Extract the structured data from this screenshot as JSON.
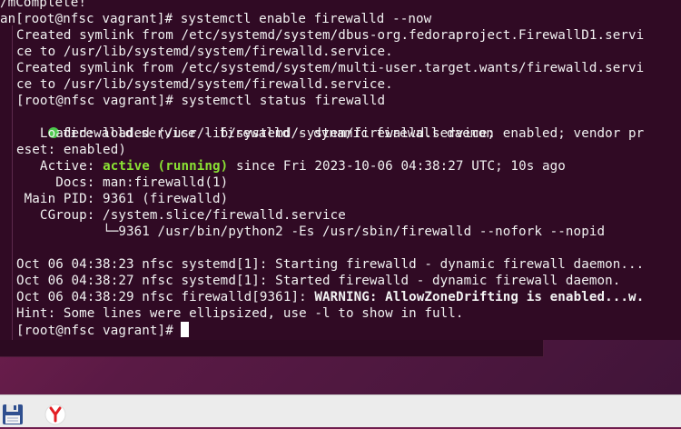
{
  "terminal": {
    "lines": [
      {
        "text": "/mComplete!"
      },
      {
        "text": "an[root@nfsc vagrant]# systemctl enable firewalld --now"
      },
      {
        "text": "Created symlink from /etc/systemd/system/dbus-org.fedoraproject.FirewallD1.servi"
      },
      {
        "text": "ce to /usr/lib/systemd/system/firewalld.service."
      },
      {
        "text": "Created symlink from /etc/systemd/system/multi-user.target.wants/firewalld.servi"
      },
      {
        "text": "ce to /usr/lib/systemd/system/firewalld.service."
      },
      {
        "text": "[root@nfsc vagrant]# systemctl status firewalld"
      },
      {
        "text": "firewalld.service - firewalld - dynamic firewall daemon"
      },
      {
        "text": "   Loaded: loaded (/usr/lib/systemd/system/firewalld.service; enabled; vendor pr"
      },
      {
        "text": "eset: enabled)"
      },
      {
        "prefix": "   Active: ",
        "highlight": "active (running)",
        "suffix": " since Fri 2023-10-06 04:38:27 UTC; 10s ago"
      },
      {
        "text": "     Docs: man:firewalld(1)"
      },
      {
        "text": " Main PID: 9361 (firewalld)"
      },
      {
        "text": "   CGroup: /system.slice/firewalld.service"
      },
      {
        "text": "           └─9361 /usr/bin/python2 -Es /usr/sbin/firewalld --nofork --nopid"
      },
      {
        "text": ""
      },
      {
        "text": "Oct 06 04:38:23 nfsc systemd[1]: Starting firewalld - dynamic firewall daemon..."
      },
      {
        "text": "Oct 06 04:38:27 nfsc systemd[1]: Started firewalld - dynamic firewall daemon."
      },
      {
        "prefix": "Oct 06 04:38:29 nfsc firewalld[9361]: ",
        "bold": "WARNING: AllowZoneDrifting is enabled...w."
      },
      {
        "text": "Hint: Some lines were ellipsized, use -l to show in full."
      },
      {
        "text": "[root@nfsc vagrant]# "
      }
    ],
    "status_dot_color": "#4ec94e"
  },
  "taskbar": {
    "icons": [
      "save-icon",
      "yandex-browser-icon"
    ]
  }
}
